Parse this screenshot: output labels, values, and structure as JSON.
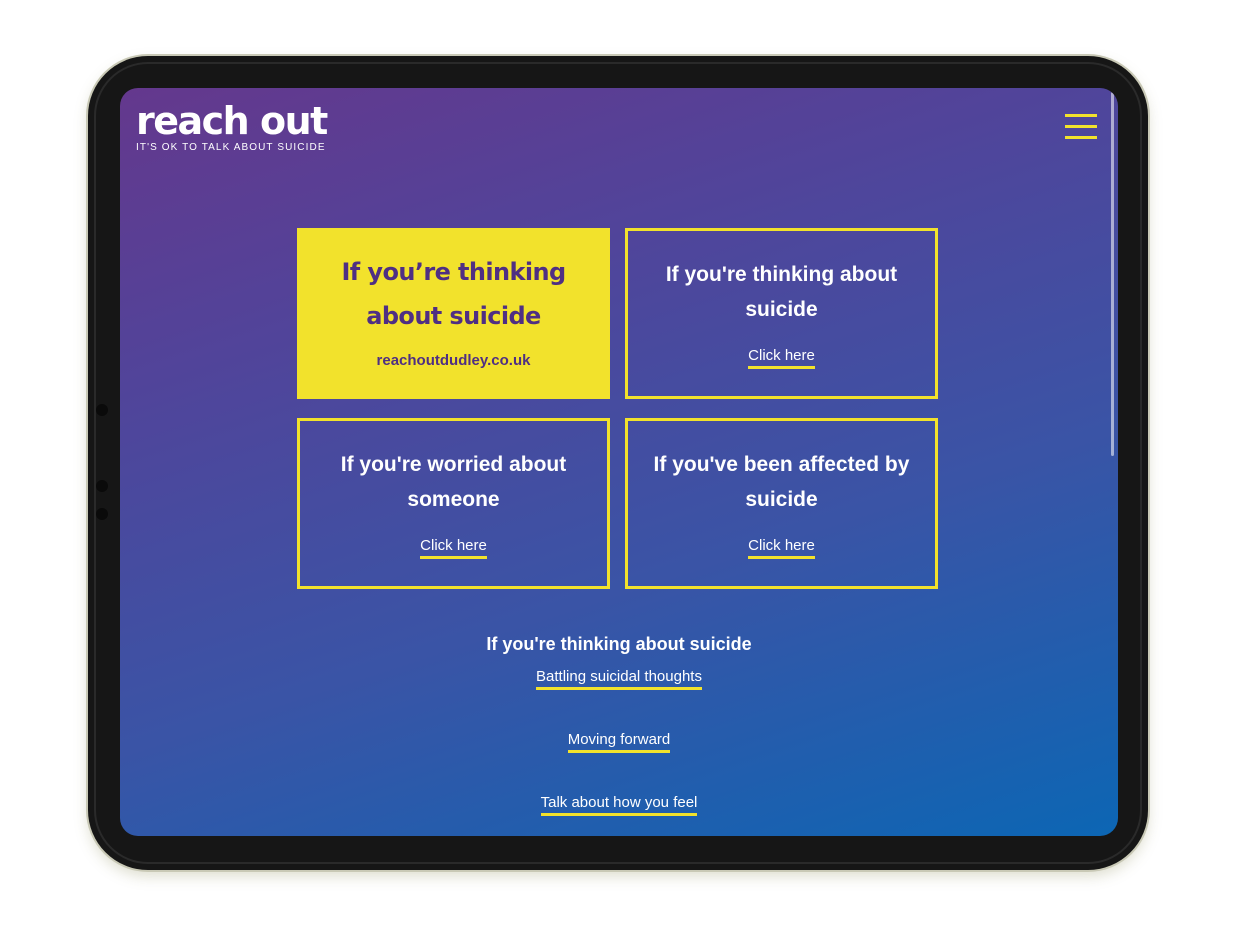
{
  "logo": {
    "title": "reach out",
    "tagline": "IT'S OK TO TALK ABOUT SUICIDE"
  },
  "header": {
    "menu_icon": "hamburger-menu-icon"
  },
  "cards": [
    {
      "heading": "If you’re thinking about suicide",
      "subtext": "reachoutdudley.co.uk"
    },
    {
      "heading": "If you're thinking about suicide",
      "cta": "Click here"
    },
    {
      "heading": "If you're worried about someone",
      "cta": "Click here"
    },
    {
      "heading": "If you've been affected by suicide",
      "cta": "Click here"
    }
  ],
  "section": {
    "title": "If you're thinking about suicide",
    "links": [
      "Battling suicidal thoughts",
      "Moving forward",
      "Talk about how you feel"
    ]
  },
  "colors": {
    "accent_yellow": "#f2e22c",
    "brand_purple": "#4f2f83",
    "gradient_top": "#64388d",
    "gradient_bottom": "#0c66b4"
  }
}
